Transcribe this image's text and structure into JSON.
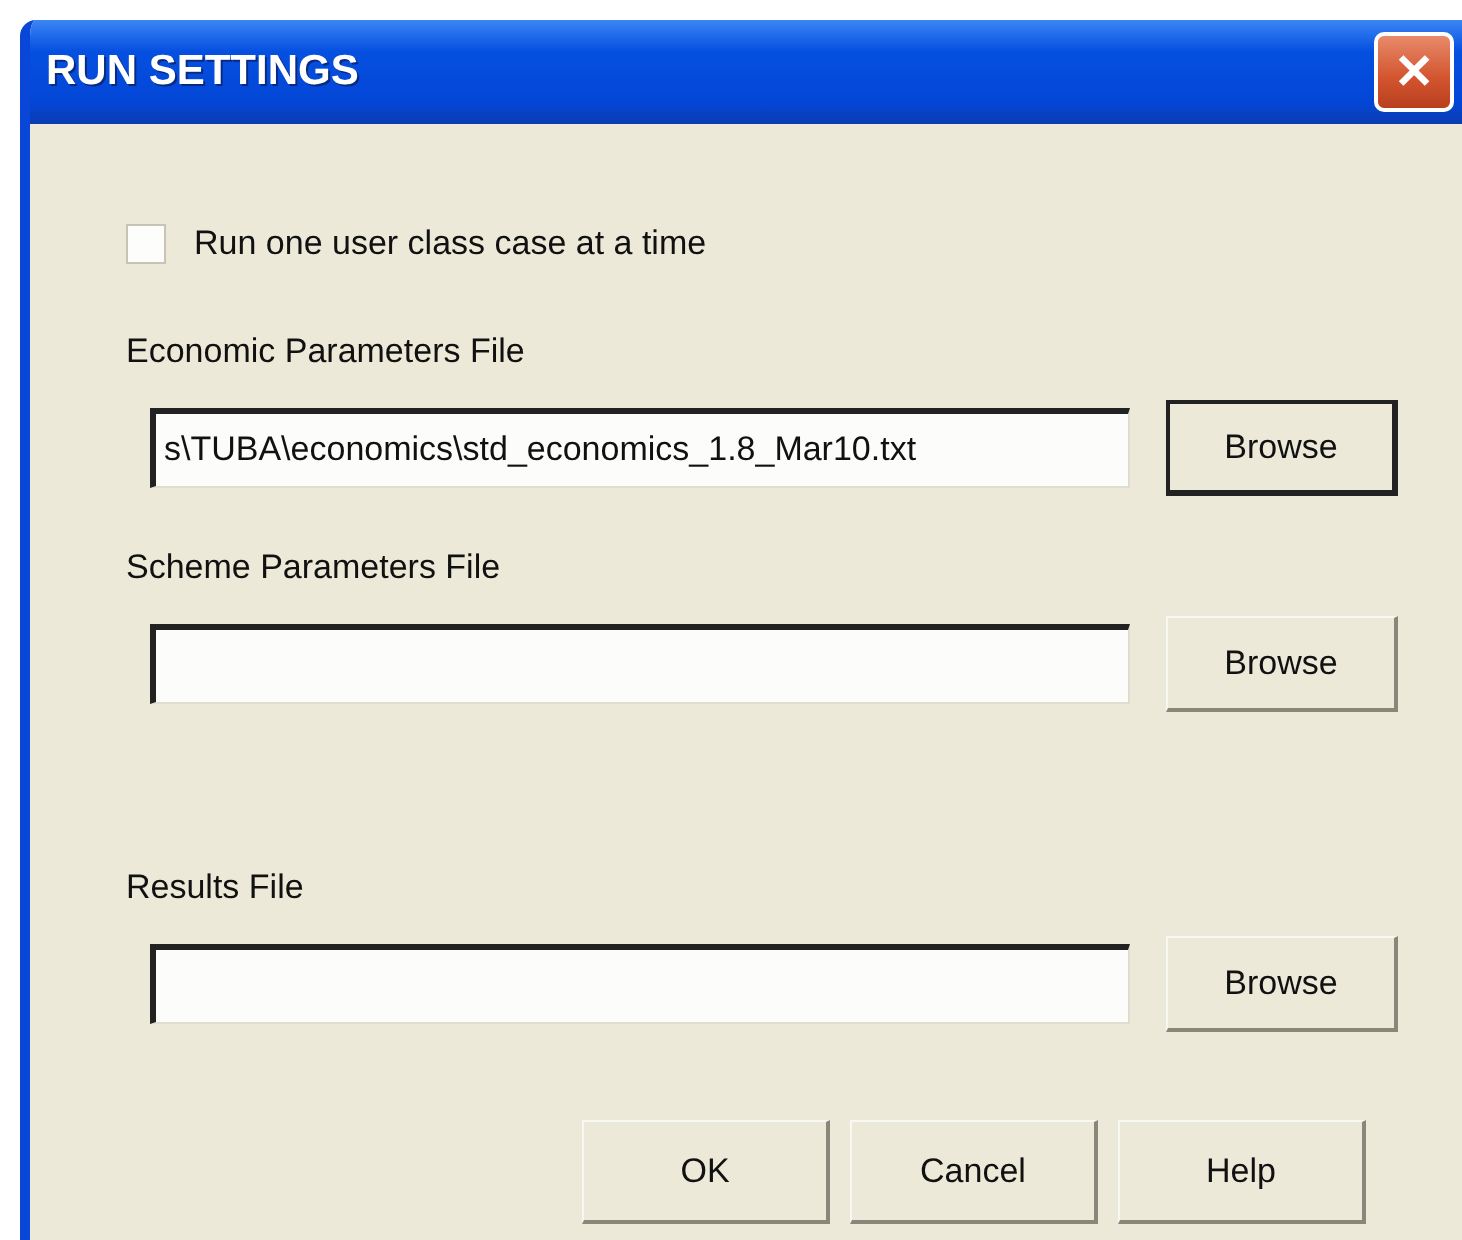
{
  "window": {
    "title": "RUN SETTINGS",
    "close": "✕"
  },
  "checkbox": {
    "label": "Run one user class case at a time",
    "checked": false
  },
  "files": [
    {
      "label": "Economic Parameters File",
      "value": "s\\TUBA\\economics\\std_economics_1.8_Mar10.txt",
      "button": "Browse",
      "default": true
    },
    {
      "label": "Scheme Parameters File",
      "button": "Browse",
      "default": false
    },
    {
      "label": "Results File",
      "button": "Browse",
      "default": false
    }
  ],
  "buttons": [
    "OK",
    "Cancel",
    "Help"
  ]
}
